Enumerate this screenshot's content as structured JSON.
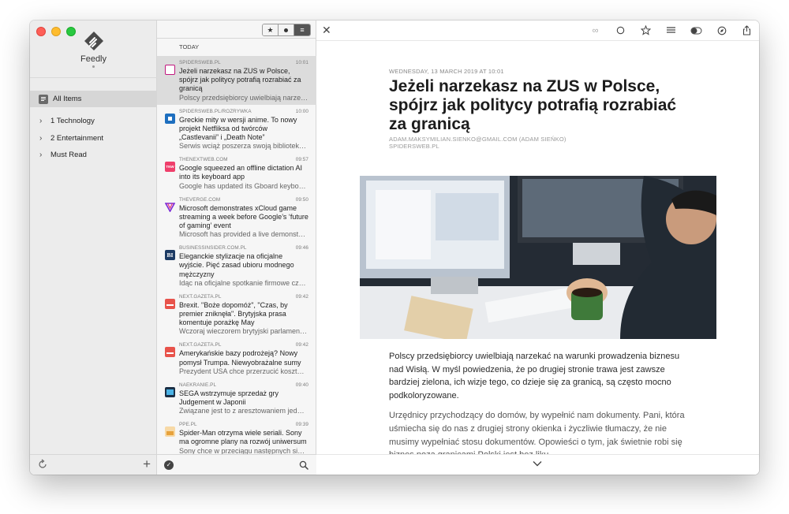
{
  "app": {
    "name": "Feedly"
  },
  "sidebar": {
    "all_items_label": "All Items",
    "items": [
      {
        "label": "1 Technology"
      },
      {
        "label": "2 Entertainment"
      },
      {
        "label": "Must Read"
      }
    ]
  },
  "list": {
    "section_label": "TODAY",
    "filters": [
      "star-filter",
      "unread-filter",
      "all-filter"
    ],
    "articles": [
      {
        "source": "SPIDERSWEB.PL",
        "time": "10:01",
        "title": "Jeżeli narzekasz na ZUS w Polsce, spójrz jak politycy potrafią rozrabiać za granicą",
        "snippet": "Polscy przedsiębiorcy uwielbiają narzeka…",
        "icon_color": "#c1177e",
        "selected": true
      },
      {
        "source": "SPIDERSWEB.PL/ROZRYWKA",
        "time": "10:00",
        "title": "Greckie mity w wersji anime. To nowy projekt Netfliksa od twórców „Castlevanii” i „Death Note”",
        "snippet": "Serwis wciąż poszerza swoją bibliotek…",
        "icon_color": "#1e6fbf"
      },
      {
        "source": "THENEXTWEB.COM",
        "time": "09:57",
        "title": "Google squeezed an offline dictation AI into its keyboard app",
        "snippet": "Google has updated its Gboard keybo…",
        "icon_color": "#ef3f6b",
        "icon_text": "TNW"
      },
      {
        "source": "THEVERGE.COM",
        "time": "09:50",
        "title": "Microsoft demonstrates xCloud game streaming a week before Google’s ‘future of gaming’ event",
        "snippet": "Microsoft has provided a live demonst…",
        "icon_color": "#7a2ad6"
      },
      {
        "source": "BUSINESSINSIDER.COM.PL",
        "time": "09:46",
        "title": "Eleganckie stylizacje na oficjalne wyjście. Pięć zasad ubioru modnego mężczyzny",
        "snippet": "Idąc na oficjalne spotkanie firmowe cz…",
        "icon_color": "#1c3a63",
        "icon_text": "BI"
      },
      {
        "source": "NEXT.GAZETA.PL",
        "time": "09:42",
        "title": "Brexit. \"Boże dopomóż\", \"Czas, by premier zniknęła\". Brytyjska prasa komentuje porażkę May",
        "snippet": "Wczoraj wieczorem brytyjski parlamen…",
        "icon_color": "#e8534b"
      },
      {
        "source": "NEXT.GAZETA.PL",
        "time": "09:42",
        "title": "Amerykańskie bazy podrożeją? Nowy pomysł Trumpa. Niewyobrażalne sumy",
        "snippet": "Prezydent USA chce przerzucić koszt…",
        "icon_color": "#e8534b"
      },
      {
        "source": "NAEKRANIE.PL",
        "time": "09:40",
        "title": "SEGA wstrzymuje sprzedaż gry Judgement w Japonii",
        "snippet": "Związane jest to z aresztowaniem jed…",
        "icon_color": "#1b2f45"
      },
      {
        "source": "PPE.PL",
        "time": "09:39",
        "title": "Spider-Man otrzyma wiele seriali. Sony ma ogromne plany na rozwój uniwersum",
        "snippet": "Sony chce w przeciągu następnych si…",
        "icon_color": "#e7a23b"
      }
    ]
  },
  "reader": {
    "date": "WEDNESDAY, 13 MARCH 2019 AT 10:01",
    "title": "Jeżeli narzekasz na ZUS w Polsce, spójrz jak politycy potrafią rozrabiać za granicą",
    "author": "ADAM.MAKSYMILIAN.SIENKO@GMAIL.COM (ADAM SIEŃKO)",
    "site": "SPIDERSWEB.PL",
    "paragraphs": [
      "Polscy przedsiębiorcy uwielbiają narzekać na warunki prowadzenia biznesu nad Wisłą. W myśl powiedzenia, że po drugiej stronie trawa jest zawsze bardziej zielona, ich wizje tego, co dzieje się za granicą, są często mocno podkoloryzowane.",
      "Urzędnicy przychodzący do domów, by wypełnić nam dokumenty. Pani, która uśmiecha się do nas z drugiej strony okienka i życzliwie tłumaczy, że nie musimy wypełniać stosu dokumentów. Opowieści o tym, jak świetnie robi się biznes poza granicami Polski jest bez liku."
    ],
    "toolbar": [
      "link-icon",
      "circle-icon",
      "star-icon",
      "list-icon",
      "toggle-icon",
      "compass-icon",
      "share-icon"
    ]
  }
}
